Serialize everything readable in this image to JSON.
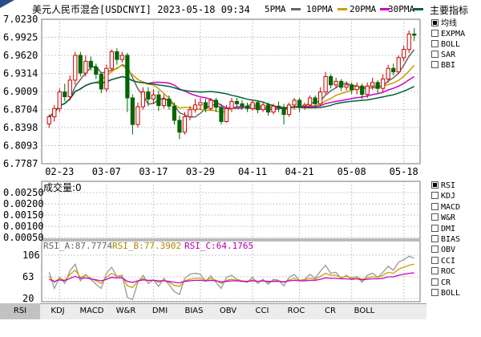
{
  "header": {
    "title": "美元人民币混合[USDCNYI] 2023-05-18 09:34"
  },
  "sidebar": {
    "main_title": "主要指标",
    "main_items": [
      {
        "label": "均线",
        "selected": true
      },
      {
        "label": "EXPMA",
        "selected": false
      },
      {
        "label": "BOLL",
        "selected": false
      },
      {
        "label": "SAR",
        "selected": false
      },
      {
        "label": "BBI",
        "selected": false
      }
    ],
    "sub_items": [
      {
        "label": "RSI",
        "selected": true
      },
      {
        "label": "KDJ",
        "selected": false
      },
      {
        "label": "MACD",
        "selected": false
      },
      {
        "label": "W&R",
        "selected": false
      },
      {
        "label": "DMI",
        "selected": false
      },
      {
        "label": "BIAS",
        "selected": false
      },
      {
        "label": "OBV",
        "selected": false
      },
      {
        "label": "CCI",
        "selected": false
      },
      {
        "label": "ROC",
        "selected": false
      },
      {
        "label": "CR",
        "selected": false
      },
      {
        "label": "BOLL",
        "selected": false
      }
    ]
  },
  "tabs": [
    "RSI",
    "KDJ",
    "MACD",
    "W&R",
    "DMI",
    "BIAS",
    "OBV",
    "CCI",
    "ROC",
    "CR",
    "BOLL"
  ],
  "colors": {
    "up": "#cc0000",
    "down": "#006600",
    "ma5": "#666666",
    "ma10": "#c8a000",
    "ma20": "#cc00cc",
    "ma30": "#006633",
    "rsi_a": "#999999",
    "rsi_b": "#c8a000",
    "rsi_c": "#cc00cc",
    "grid": "#c8c8c8"
  },
  "chart_data": {
    "type": "candlestick",
    "ma_legend": [
      {
        "name": "5PMA"
      },
      {
        "name": "10PMA"
      },
      {
        "name": "20PMA"
      },
      {
        "name": "30PMA"
      }
    ],
    "price_axis": {
      "ticks": [
        "7.0230",
        "6.9925",
        "6.9620",
        "6.9314",
        "6.9009",
        "6.8704",
        "6.8398",
        "6.8093",
        "6.7787"
      ],
      "ylim": [
        6.7787,
        7.023
      ]
    },
    "date_ticks": [
      "02-23",
      "03-07",
      "03-17",
      "03-29",
      "04-11",
      "04-21",
      "05-08",
      "05-18"
    ],
    "candles": [
      [
        6.846,
        6.858,
        6.839,
        6.862
      ],
      [
        6.858,
        6.872,
        6.85,
        6.878
      ],
      [
        6.872,
        6.9,
        6.866,
        6.906
      ],
      [
        6.9,
        6.892,
        6.884,
        6.914
      ],
      [
        6.892,
        6.92,
        6.886,
        6.928
      ],
      [
        6.92,
        6.962,
        6.912,
        6.968
      ],
      [
        6.962,
        6.932,
        6.926,
        6.968
      ],
      [
        6.932,
        6.952,
        6.926,
        6.962
      ],
      [
        6.952,
        6.942,
        6.936,
        6.96
      ],
      [
        6.942,
        6.93,
        6.922,
        6.948
      ],
      [
        6.93,
        6.905,
        6.898,
        6.934
      ],
      [
        6.905,
        6.94,
        6.9,
        6.946
      ],
      [
        6.94,
        6.968,
        6.936,
        6.972
      ],
      [
        6.968,
        6.955,
        6.946,
        6.974
      ],
      [
        6.955,
        6.962,
        6.95,
        6.968
      ],
      [
        6.962,
        6.89,
        6.866,
        6.966
      ],
      [
        6.89,
        6.845,
        6.828,
        6.896
      ],
      [
        6.845,
        6.875,
        6.84,
        6.882
      ],
      [
        6.875,
        6.9,
        6.87,
        6.908
      ],
      [
        6.9,
        6.888,
        6.876,
        6.908
      ],
      [
        6.888,
        6.895,
        6.88,
        6.905
      ],
      [
        6.895,
        6.877,
        6.868,
        6.902
      ],
      [
        6.877,
        6.888,
        6.872,
        6.896
      ],
      [
        6.888,
        6.876,
        6.87,
        6.894
      ],
      [
        6.876,
        6.852,
        6.845,
        6.882
      ],
      [
        6.852,
        6.832,
        6.82,
        6.86
      ],
      [
        6.832,
        6.858,
        6.828,
        6.866
      ],
      [
        6.858,
        6.87,
        6.852,
        6.876
      ],
      [
        6.87,
        6.878,
        6.865,
        6.888
      ],
      [
        6.878,
        6.882,
        6.87,
        6.89
      ],
      [
        6.882,
        6.872,
        6.866,
        6.888
      ],
      [
        6.872,
        6.886,
        6.868,
        6.89
      ],
      [
        6.886,
        6.874,
        6.866,
        6.89
      ],
      [
        6.874,
        6.85,
        6.845,
        6.88
      ],
      [
        6.85,
        6.872,
        6.848,
        6.878
      ],
      [
        6.872,
        6.884,
        6.866,
        6.89
      ],
      [
        6.884,
        6.88,
        6.874,
        6.89
      ],
      [
        6.88,
        6.876,
        6.87,
        6.886
      ],
      [
        6.876,
        6.872,
        6.866,
        6.882
      ],
      [
        6.872,
        6.882,
        6.868,
        6.886
      ],
      [
        6.882,
        6.87,
        6.864,
        6.884
      ],
      [
        6.87,
        6.878,
        6.866,
        6.882
      ],
      [
        6.878,
        6.866,
        6.86,
        6.882
      ],
      [
        6.866,
        6.876,
        6.862,
        6.88
      ],
      [
        6.876,
        6.874,
        6.866,
        6.884
      ],
      [
        6.874,
        6.862,
        6.845,
        6.88
      ],
      [
        6.862,
        6.878,
        6.858,
        6.882
      ],
      [
        6.878,
        6.886,
        6.87,
        6.89
      ],
      [
        6.886,
        6.876,
        6.866,
        6.89
      ],
      [
        6.876,
        6.878,
        6.87,
        6.882
      ],
      [
        6.878,
        6.89,
        6.874,
        6.894
      ],
      [
        6.89,
        6.88,
        6.874,
        6.894
      ],
      [
        6.88,
        6.9,
        6.876,
        6.908
      ],
      [
        6.9,
        6.926,
        6.896,
        6.934
      ],
      [
        6.926,
        6.912,
        6.906,
        6.93
      ],
      [
        6.912,
        6.918,
        6.906,
        6.924
      ],
      [
        6.918,
        6.908,
        6.902,
        6.922
      ],
      [
        6.908,
        6.912,
        6.902,
        6.918
      ],
      [
        6.912,
        6.904,
        6.896,
        6.916
      ],
      [
        6.904,
        6.91,
        6.896,
        6.916
      ],
      [
        6.91,
        6.896,
        6.888,
        6.914
      ],
      [
        6.896,
        6.91,
        6.89,
        6.916
      ],
      [
        6.91,
        6.916,
        6.904,
        6.924
      ],
      [
        6.916,
        6.906,
        6.898,
        6.92
      ],
      [
        6.906,
        6.922,
        6.9,
        6.93
      ],
      [
        6.922,
        6.94,
        6.916,
        6.946
      ],
      [
        6.94,
        6.934,
        6.928,
        6.948
      ],
      [
        6.934,
        6.958,
        6.93,
        6.962
      ],
      [
        6.958,
        6.972,
        6.952,
        6.978
      ],
      [
        6.972,
        6.998,
        6.966,
        7.004
      ],
      [
        6.998,
        6.996,
        6.986,
        7.008
      ]
    ],
    "volume": {
      "label": "成交量:0",
      "ticks": [
        "0.00250",
        "0.00200",
        "0.00150",
        "0.00100",
        "0.00050"
      ]
    },
    "rsi": {
      "label_a": "RSI_A:87.7774",
      "label_b": "RSI_B:77.3902",
      "label_c": "RSI_C:64.1765",
      "ticks": [
        "106",
        "63",
        "20"
      ],
      "ylim": [
        20,
        106
      ],
      "a": [
        72,
        40,
        62,
        50,
        75,
        88,
        55,
        68,
        58,
        48,
        40,
        70,
        82,
        64,
        66,
        22,
        18,
        52,
        66,
        50,
        57,
        44,
        60,
        47,
        34,
        28,
        60,
        68,
        70,
        68,
        54,
        65,
        52,
        40,
        62,
        66,
        58,
        55,
        52,
        62,
        50,
        58,
        48,
        58,
        56,
        45,
        62,
        68,
        56,
        58,
        68,
        60,
        74,
        86,
        70,
        72,
        60,
        66,
        58,
        64,
        52,
        66,
        70,
        62,
        72,
        84,
        76,
        92,
        97,
        104,
        100
      ],
      "b": [
        64,
        52,
        60,
        56,
        68,
        76,
        62,
        66,
        60,
        55,
        50,
        62,
        70,
        64,
        64,
        45,
        42,
        54,
        60,
        55,
        57,
        52,
        56,
        52,
        46,
        44,
        55,
        58,
        60,
        60,
        56,
        60,
        56,
        50,
        56,
        58,
        56,
        55,
        54,
        57,
        54,
        56,
        52,
        55,
        55,
        52,
        57,
        60,
        56,
        57,
        60,
        58,
        64,
        70,
        66,
        66,
        62,
        64,
        61,
        62,
        58,
        61,
        63,
        62,
        66,
        72,
        70,
        78,
        82,
        86,
        88
      ],
      "c": [
        58,
        54,
        57,
        55,
        60,
        64,
        60,
        61,
        59,
        57,
        55,
        58,
        62,
        61,
        61,
        54,
        52,
        55,
        57,
        56,
        56,
        55,
        55,
        54,
        52,
        51,
        54,
        55,
        56,
        56,
        55,
        56,
        55,
        53,
        54,
        55,
        55,
        54,
        54,
        55,
        54,
        55,
        54,
        54,
        54,
        53,
        55,
        56,
        55,
        55,
        56,
        56,
        58,
        61,
        60,
        60,
        59,
        59,
        58,
        59,
        57,
        58,
        59,
        59,
        60,
        63,
        63,
        66,
        68,
        70,
        71
      ]
    }
  }
}
